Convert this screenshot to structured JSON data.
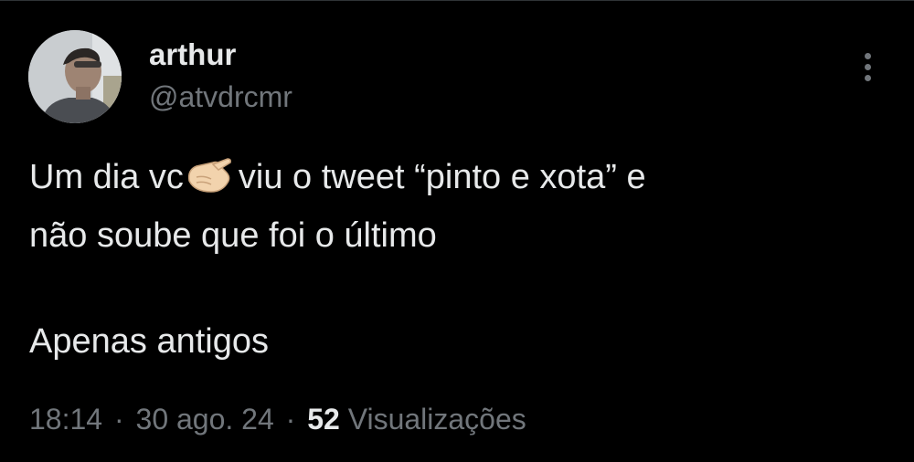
{
  "author": {
    "display_name": "arthur",
    "handle": "@atvdrcmr",
    "avatar_icon": "profile-photo"
  },
  "tweet": {
    "line1_before_emoji": "Um dia vc",
    "emoji": "backhand-index-pointing-at-viewer",
    "line1_after_emoji": "viu o tweet “pinto e xota” e",
    "line2": "não soube que foi o último",
    "line3": "Apenas antigos"
  },
  "meta": {
    "time": "18:14",
    "separator": "·",
    "date": "30 ago. 24",
    "views_count": "52",
    "views_label": "Visualizações"
  },
  "menu": {
    "icon": "vertical-ellipsis"
  },
  "colors": {
    "background": "#000000",
    "primary_text": "#e7e9ea",
    "secondary_text": "#71767b"
  }
}
